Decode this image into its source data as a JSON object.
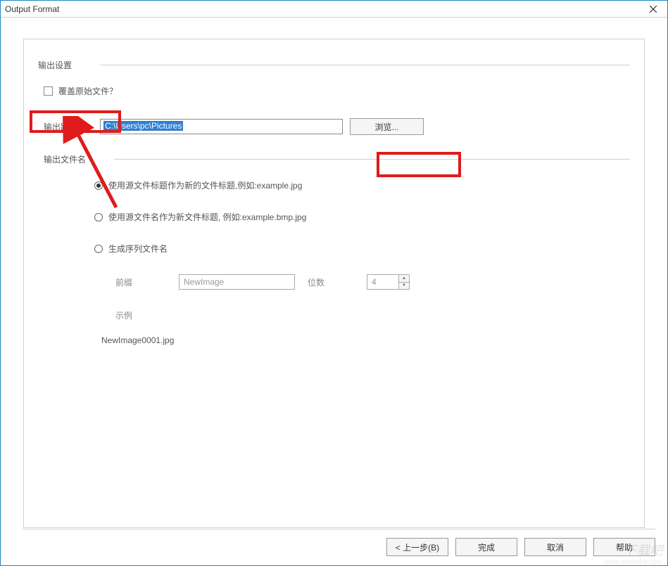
{
  "window": {
    "title": "Output Format"
  },
  "outputSettings": {
    "label": "输出设置",
    "overwrite": {
      "label": "覆盖原始文件？",
      "checked": false
    },
    "outputPath": {
      "label": "输出路径:",
      "value": "C:\\Users\\pc\\Pictures",
      "browseButton": "浏览..."
    }
  },
  "outputFilename": {
    "label": "输出文件名",
    "options": [
      {
        "label": "使用源文件标题作为新的文件标题,例如:example.jpg",
        "selected": true
      },
      {
        "label": "使用源文件名作为新文件标题, 例如:example.bmp.jpg",
        "selected": false
      },
      {
        "label": "生成序列文件名",
        "selected": false
      }
    ],
    "sequence": {
      "prefixLabel": "前缀",
      "prefixValue": "NewImage",
      "digitsLabel": "位数",
      "digitsValue": "4",
      "exampleLabel": "示例",
      "exampleValue": "NewImage0001.jpg"
    }
  },
  "footer": {
    "back": "< 上一步(B)",
    "finish": "完成",
    "cancel": "取消",
    "help": "帮助"
  },
  "watermark": {
    "main": "下载吧",
    "sub": "www.xiazaiba.com"
  }
}
